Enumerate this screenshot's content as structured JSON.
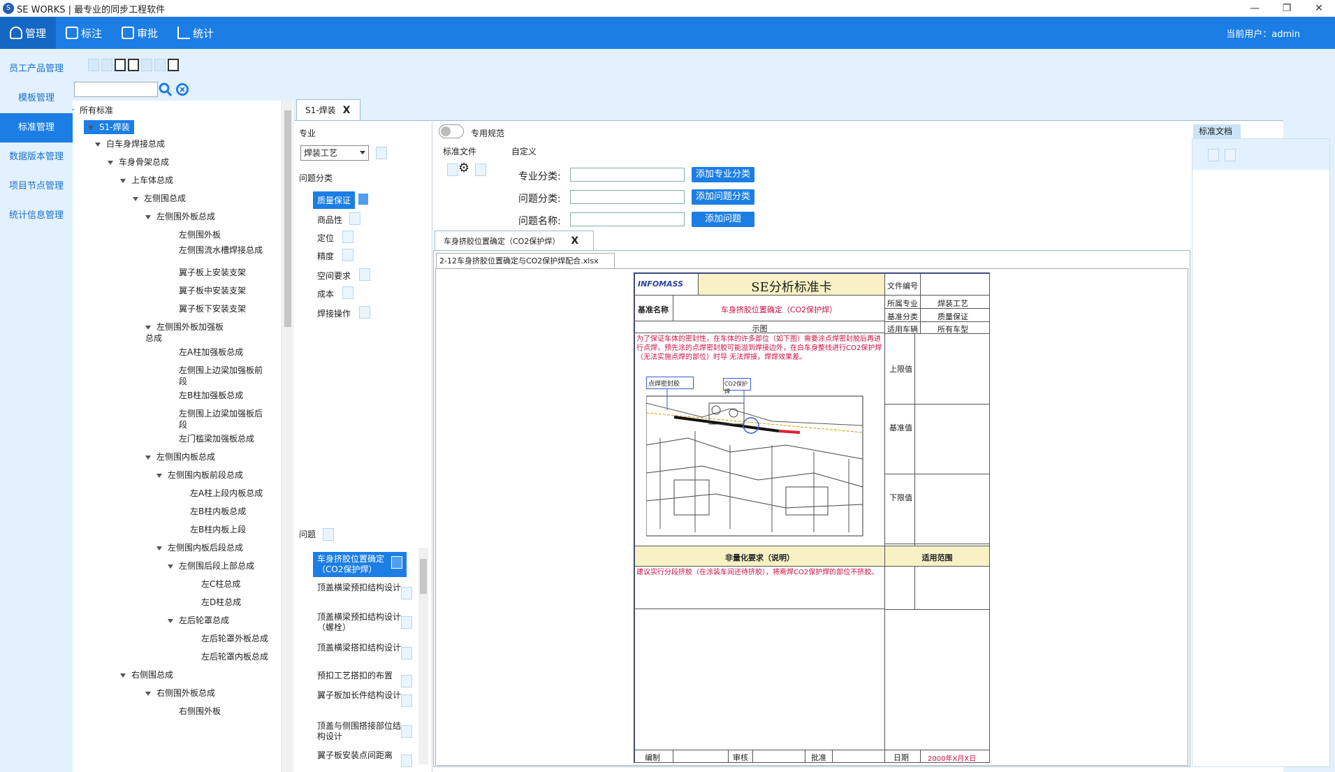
{
  "window": {
    "title": "SE WORKS | 最专业的同步工程软件",
    "minimize": "—",
    "restore": "❐",
    "close": "✕"
  },
  "topnav": {
    "tabs": [
      {
        "label": "管理",
        "icon": "user-icon"
      },
      {
        "label": "标注",
        "icon": "edit-icon"
      },
      {
        "label": "审批",
        "icon": "approve-icon"
      },
      {
        "label": "统计",
        "icon": "chart-icon"
      }
    ],
    "current_user": "当前用户：admin"
  },
  "sidebar": {
    "items": [
      "员工产品管理",
      "模板管理",
      "标准管理",
      "数据版本管理",
      "项目节点管理",
      "统计信息管理"
    ],
    "active_index": 2
  },
  "tree": {
    "nodes": [
      {
        "label": "所有标准"
      },
      {
        "label": "S1-焊装"
      },
      {
        "label": "白车身焊接总成"
      },
      {
        "label": "车身骨架总成"
      },
      {
        "label": "上车体总成"
      },
      {
        "label": "左侧围总成"
      },
      {
        "label": "左侧围外板总成"
      },
      {
        "label": "左侧围外板"
      },
      {
        "label": "左侧围流水槽焊接总成"
      },
      {
        "label": "翼子板上安装支架"
      },
      {
        "label": "翼子板中安装支架"
      },
      {
        "label": "翼子板下安装支架"
      },
      {
        "label": "左侧围外板加强板总成"
      },
      {
        "label": "左A柱加强板总成"
      },
      {
        "label": "左侧围上边梁加强板前段"
      },
      {
        "label": "左B柱加强板总成"
      },
      {
        "label": "左侧围上边梁加强板后段"
      },
      {
        "label": "左门槛梁加强板总成"
      },
      {
        "label": "左侧围内板总成"
      },
      {
        "label": "左侧围内板前段总成"
      },
      {
        "label": "左A柱上段内板总成"
      },
      {
        "label": "左B柱内板总成"
      },
      {
        "label": "左B柱内板上段"
      },
      {
        "label": "左侧围内板后段总成"
      },
      {
        "label": "左侧围后段上部总成"
      },
      {
        "label": "左C柱总成"
      },
      {
        "label": "左D柱总成"
      },
      {
        "label": "左后轮罩总成"
      },
      {
        "label": "左后轮罩外板总成"
      },
      {
        "label": "左后轮罩内板总成"
      },
      {
        "label": "右侧围总成"
      },
      {
        "label": "右侧围外板总成"
      },
      {
        "label": "右侧围外板"
      }
    ]
  },
  "main_tab": {
    "label": "S1-焊装",
    "close": "X"
  },
  "left_panel": {
    "major_label": "专业",
    "major_value": "焊装工艺",
    "category_label": "问题分类",
    "categories": [
      "质量保证",
      "商品性",
      "定位",
      "精度",
      "空间要求",
      "成本",
      "焊接操作"
    ],
    "problem_label": "问题",
    "problems": [
      "车身挤胶位置确定（CO2保护焊）",
      "顶盖横梁预扣结构设计",
      "顶盖横梁预扣结构设计（螺栓）",
      "顶盖横梁搭扣结构设计",
      "预扣工艺搭扣的布置",
      "翼子板加长件结构设计",
      "顶盖与侧围搭接部位结构设计",
      "翼子板安装点间距离"
    ]
  },
  "form": {
    "special_spec": "专用规范",
    "std_file": "标准文件",
    "custom": "自定义",
    "major_cat_label": "专业分类:",
    "problem_cat_label": "问题分类:",
    "problem_name_label": "问题名称:",
    "add_major_cat": "添加专业分类",
    "add_problem_cat": "添加问题分类",
    "add_problem": "添加问题"
  },
  "doc_tab": {
    "label": "车身挤胶位置确定（CO2保护焊）",
    "close": "X"
  },
  "file_tab": {
    "label": "2-12车身挤胶位置确定与CO2保护焊配合.xlsx"
  },
  "card": {
    "logo": "INFOMASS",
    "title": "SE分析标准卡",
    "doc_no_label": "文件编号",
    "std_name_label": "基准名称",
    "std_name_value": "车身挤胶位置确定（CO2保护焊）",
    "major_label": "所属专业",
    "major_value": "焊装工艺",
    "std_cat_label": "基准分类",
    "std_cat_value": "质量保证",
    "vehicle_label": "适用车辆",
    "vehicle_value": "所有车型",
    "diagram_label": "示图",
    "description": "为了保证车体的密封性，在车体的许多部位（如下图）需要涂点焊密封胶后再进行点焊，预先涂的点焊密封胶可能溢到焊接边外，在白车身整线进行CO2保护焊（无法实施点焊的部位）时导 无法焊接，焊焊效果差。",
    "callout_1": "点焊密封胶",
    "callout_2": "CO2保护焊",
    "upper_limit": "上限值",
    "base_value": "基准值",
    "lower_limit": "下限值",
    "nonquant_label": "非量化要求（说明）",
    "scope_label": "适用范围",
    "nonquant_text": "建议实行分段挤胶（在涂装车间还待挤胶），将需焊CO2保护焊的部位不挤胶。",
    "footer": {
      "editor": "编制",
      "reviewer": "审核",
      "approver": "批准",
      "date_label": "日期",
      "date_value": "2000年X月X日"
    }
  },
  "right_panel": {
    "tab_label": "标准文档"
  },
  "colors": {
    "accent": "#1c7ee4",
    "sidebar_bg": "#e2f1fd",
    "card_red": "#d01040",
    "card_yellow": "#f7f1c5"
  }
}
